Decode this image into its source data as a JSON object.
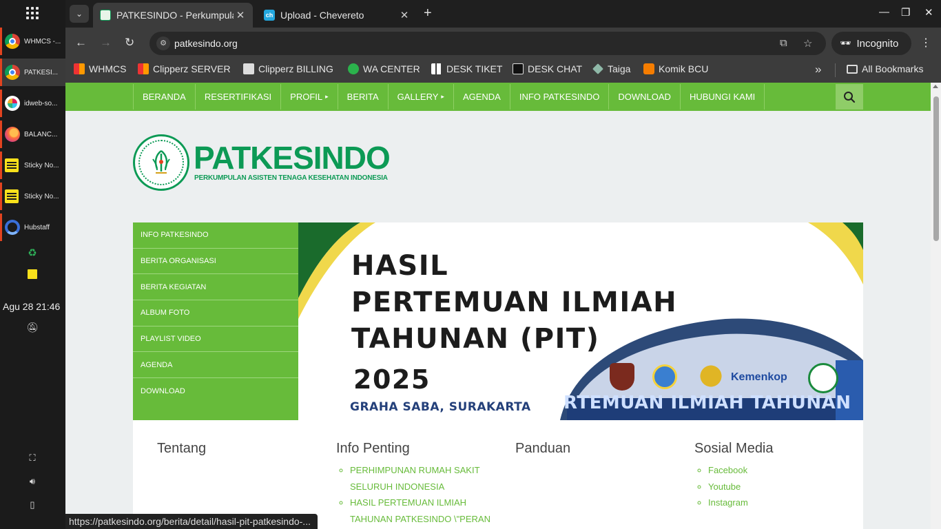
{
  "taskbar": {
    "items": [
      {
        "label": "WHMCS -...",
        "icon": "chrome-icon"
      },
      {
        "label": "PATKESI...",
        "icon": "chrome-icon"
      },
      {
        "label": "idweb-so...",
        "icon": "slack-icon"
      },
      {
        "label": "BALANC...",
        "icon": "firefox-icon"
      },
      {
        "label": "Sticky No...",
        "icon": "sticky-notes-icon"
      },
      {
        "label": "Sticky No...",
        "icon": "sticky-notes-icon"
      },
      {
        "label": "Hubstaff",
        "icon": "hubstaff-icon"
      }
    ],
    "clock": "Agu 28  21:46"
  },
  "browser": {
    "tabs": [
      {
        "title": "PATKESINDO - Perkumpulan",
        "active": true
      },
      {
        "title": "Upload - Chevereto",
        "active": false
      }
    ],
    "url": "patkesindo.org",
    "incognito_label": "Incognito",
    "bookmarks": [
      "WHMCS",
      "Clipperz SERVER",
      "Clipperz BILLING",
      "WA CENTER",
      "DESK TIKET",
      "DESK CHAT",
      "Taiga",
      "Komik BCU"
    ],
    "all_bookmarks": "All Bookmarks",
    "status_url": "https://patkesindo.org/berita/detail/hasil-pit-patkesindo-..."
  },
  "site": {
    "nav": [
      "BERANDA",
      "RESERTIFIKASI",
      "PROFIL",
      "BERITA",
      "GALLERY",
      "AGENDA",
      "INFO PATKESINDO",
      "DOWNLOAD",
      "HUBUNGI KAMI"
    ],
    "brand": "PATKESINDO",
    "brand_sub": "PERKUMPULAN ASISTEN TENAGA KESEHATAN INDONESIA",
    "side_menu": [
      "INFO PATKESINDO",
      "BERITA ORGANISASI",
      "BERITA KEGIATAN",
      "ALBUM FOTO",
      "PLAYLIST VIDEO",
      "AGENDA",
      "DOWNLOAD"
    ],
    "banner": {
      "line1": "HASIL",
      "line2": "PERTEMUAN ILMIAH",
      "line3": "TAHUNAN (PIT)",
      "year": "2025",
      "location": "GRAHA SABA, SURAKARTA",
      "stage_text": "RTEMUAN ILMIAH TAHUNAN",
      "sponsor": "Kemenkop"
    },
    "footer": {
      "tentang": {
        "title": "Tentang"
      },
      "info_penting": {
        "title": "Info Penting",
        "items": [
          "PERHIMPUNAN RUMAH SAKIT SELURUH INDONESIA",
          "HASIL PERTEMUAN ILMIAH TAHUNAN PATKESINDO \\\"PERAN"
        ]
      },
      "panduan": {
        "title": "Panduan"
      },
      "sosial": {
        "title": "Sosial Media",
        "items": [
          "Facebook",
          "Youtube",
          "Instagram"
        ]
      }
    }
  },
  "colors": {
    "brand_green": "#67bb3a",
    "logo_green": "#0c9a55"
  }
}
